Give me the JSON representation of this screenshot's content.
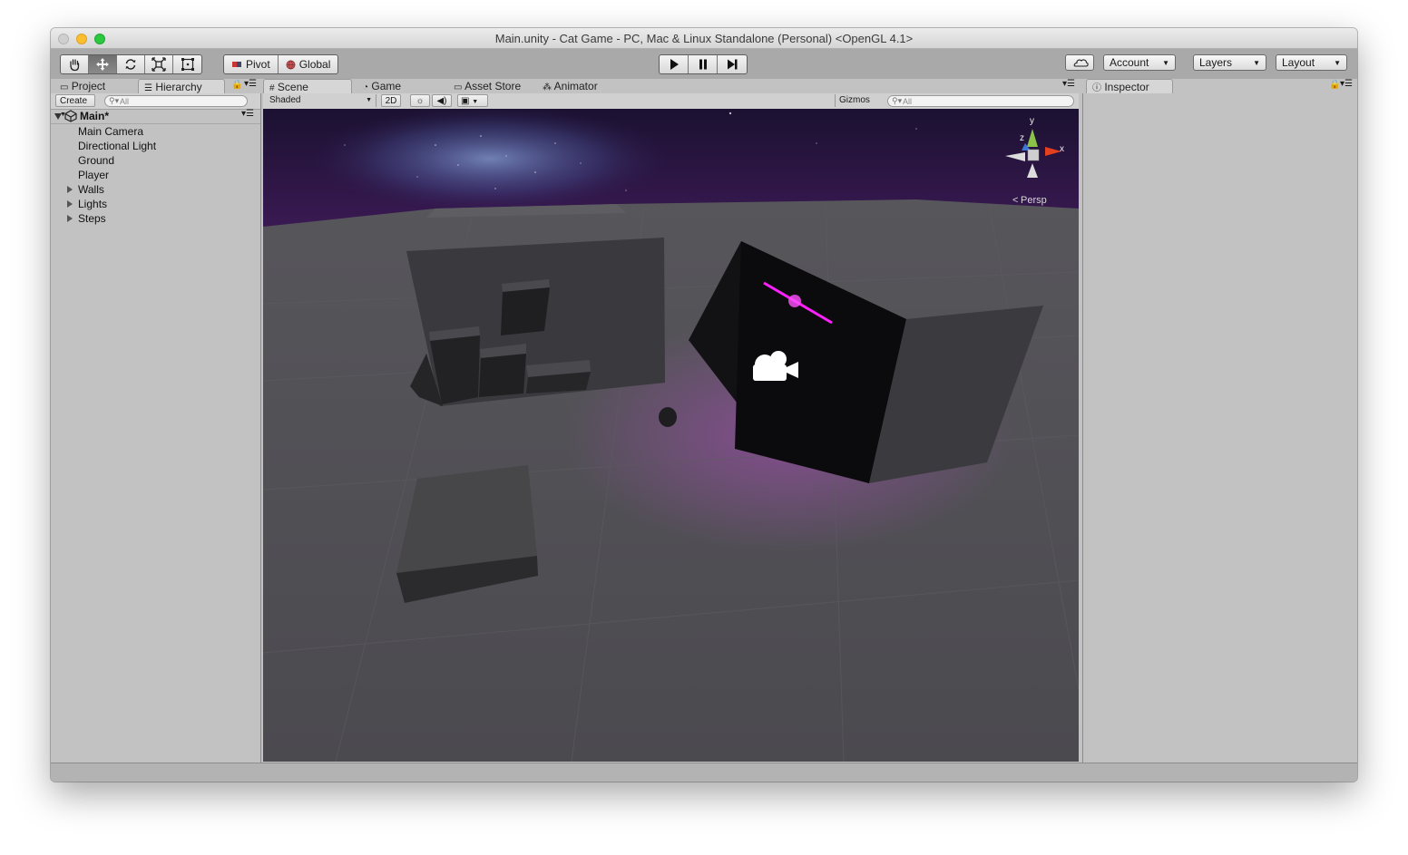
{
  "window": {
    "title": "Main.unity - Cat Game - PC, Mac & Linux Standalone (Personal) <OpenGL 4.1>"
  },
  "toolbar": {
    "tools": [
      "hand-icon",
      "move-icon",
      "rotate-icon",
      "scale-icon",
      "rect-icon"
    ],
    "active_tool": "move-icon",
    "pivot_label": "Pivot",
    "global_label": "Global",
    "play": [
      "play-icon",
      "pause-icon",
      "step-icon"
    ],
    "account_label": "Account",
    "layers_label": "Layers",
    "layout_label": "Layout"
  },
  "left_panel": {
    "tabs": [
      {
        "label": "Project",
        "active": false
      },
      {
        "label": "Hierarchy",
        "active": true
      }
    ],
    "create_label": "Create",
    "search_placeholder": "All",
    "scene_name": "Main*",
    "items": [
      {
        "label": "Main Camera",
        "expandable": false
      },
      {
        "label": "Directional Light",
        "expandable": false
      },
      {
        "label": "Ground",
        "expandable": false
      },
      {
        "label": "Player",
        "expandable": false
      },
      {
        "label": "Walls",
        "expandable": true
      },
      {
        "label": "Lights",
        "expandable": true
      },
      {
        "label": "Steps",
        "expandable": true
      }
    ]
  },
  "center_panel": {
    "tabs": [
      {
        "label": "Scene",
        "active": true
      },
      {
        "label": "Game",
        "active": false
      },
      {
        "label": "Asset Store",
        "active": false
      },
      {
        "label": "Animator",
        "active": false
      }
    ],
    "shading_mode": "Shaded",
    "mode_2d_label": "2D",
    "gizmos_label": "Gizmos",
    "search_placeholder": "All",
    "gizmo": {
      "y_label": "y",
      "x_label": "x",
      "z_label": "z",
      "projection_label": "Persp"
    }
  },
  "right_panel": {
    "tabs": [
      {
        "label": "Inspector",
        "active": true
      }
    ]
  },
  "colors": {
    "accent_light": "#ff20ff",
    "sky_top": "#1a1030",
    "ground": "#4a4a4e"
  }
}
